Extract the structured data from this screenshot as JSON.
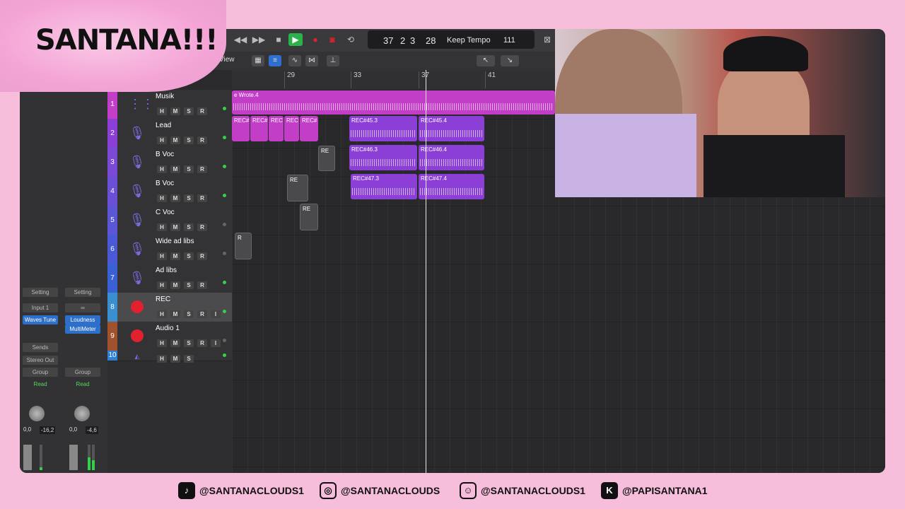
{
  "logo": {
    "text": "SANTANA!!!"
  },
  "transport": {
    "bars": "37",
    "beat": "2",
    "div": "3",
    "tick": "28",
    "tempo_mode": "Keep Tempo",
    "bpm": "111"
  },
  "toolbar2": {
    "view_label": "View"
  },
  "ruler": {
    "bars": [
      "29",
      "33",
      "37",
      "41"
    ]
  },
  "tracks": [
    {
      "num": "1",
      "name": "Musik",
      "buttons": [
        "H",
        "M",
        "S",
        "R"
      ],
      "color": "#c23ec7",
      "icon": "waveform-icon"
    },
    {
      "num": "2",
      "name": "Lead",
      "buttons": [
        "H",
        "M",
        "S",
        "R"
      ],
      "color": "#8b3fd6",
      "icon": "microphone-icon"
    },
    {
      "num": "3",
      "name": "B Voc",
      "buttons": [
        "H",
        "M",
        "S",
        "R"
      ],
      "color": "#7a4ad6",
      "icon": "microphone-icon"
    },
    {
      "num": "4",
      "name": "B Voc",
      "buttons": [
        "H",
        "M",
        "S",
        "R"
      ],
      "color": "#6a50d6",
      "icon": "microphone-icon"
    },
    {
      "num": "5",
      "name": "C Voc",
      "buttons": [
        "H",
        "M",
        "S",
        "R"
      ],
      "color": "#5a56d6",
      "icon": "microphone-icon"
    },
    {
      "num": "6",
      "name": "Wide ad libs",
      "buttons": [
        "H",
        "M",
        "S",
        "R"
      ],
      "color": "#4a5ad6",
      "icon": "microphone-icon"
    },
    {
      "num": "7",
      "name": "Ad libs",
      "buttons": [
        "H",
        "M",
        "S",
        "R"
      ],
      "color": "#3a60d6",
      "icon": "microphone-icon"
    },
    {
      "num": "8",
      "name": "REC",
      "buttons": [
        "H",
        "M",
        "S",
        "R",
        "I"
      ],
      "color": "#3a8fd0",
      "icon": "record-icon"
    },
    {
      "num": "9",
      "name": "Audio 1",
      "buttons": [
        "H",
        "M",
        "S",
        "R",
        "I"
      ],
      "color": "#a0522d",
      "icon": "record-icon"
    },
    {
      "num": "10",
      "name": "",
      "buttons": [
        "H",
        "M",
        "S"
      ],
      "color": "#2e7fd6",
      "icon": "output-icon"
    }
  ],
  "regions": {
    "musik": "e Wrote.4",
    "lead_short": [
      "REC#",
      "REC#",
      "REC",
      "REC",
      "REC#"
    ],
    "r1": "REC#45.3",
    "r2": "REC#45.4",
    "r3": "REC#46.3",
    "r4": "REC#46.4",
    "r5": "REC#47.3",
    "r6": "REC#47.4",
    "s3": "RE",
    "s4": "RE",
    "s5": "RE",
    "s6": "R"
  },
  "inspector": {
    "setting_a": "Setting",
    "setting_b": "Setting",
    "input": "Input 1",
    "plugin_a": "Waves Tune",
    "plugin_b1": "Loudness",
    "plugin_b2": "MultiMeter",
    "sends": "Sends",
    "output": "Stereo Out",
    "group_a": "Group",
    "group_b": "Group",
    "read_a": "Read",
    "read_b": "Read",
    "vol_a": "0,0",
    "peak_a": "-16,2",
    "vol_b": "0,0",
    "peak_b": "-4,6"
  },
  "socials": [
    {
      "icon": "tiktok-icon",
      "glyph": "♪",
      "handle": "@SANTANACLOUDS1"
    },
    {
      "icon": "instagram-icon",
      "glyph": "◎",
      "handle": "@SANTANACLOUDS"
    },
    {
      "icon": "snapchat-icon",
      "glyph": "☺",
      "handle": "@SANTANACLOUDS1"
    },
    {
      "icon": "kick-icon",
      "glyph": "K",
      "handle": "@PAPISANTANA1"
    }
  ]
}
